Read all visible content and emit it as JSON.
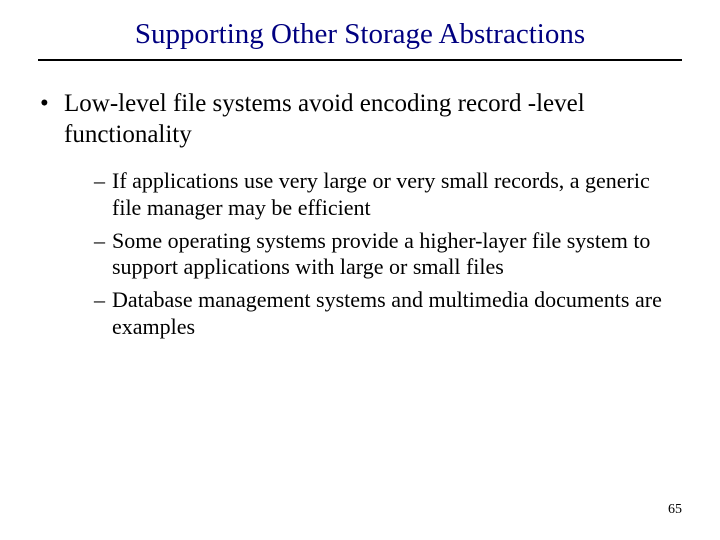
{
  "title": "Supporting Other Storage Abstractions",
  "main_bullet": "Low-level file systems avoid encoding record -level functionality",
  "sub_bullets": [
    "If applications use very large or very small records, a generic file manager may be efficient",
    "Some operating systems provide a higher-layer file system to support applications with large or small files",
    "Database management systems and multimedia documents are examples"
  ],
  "page_number": "65"
}
